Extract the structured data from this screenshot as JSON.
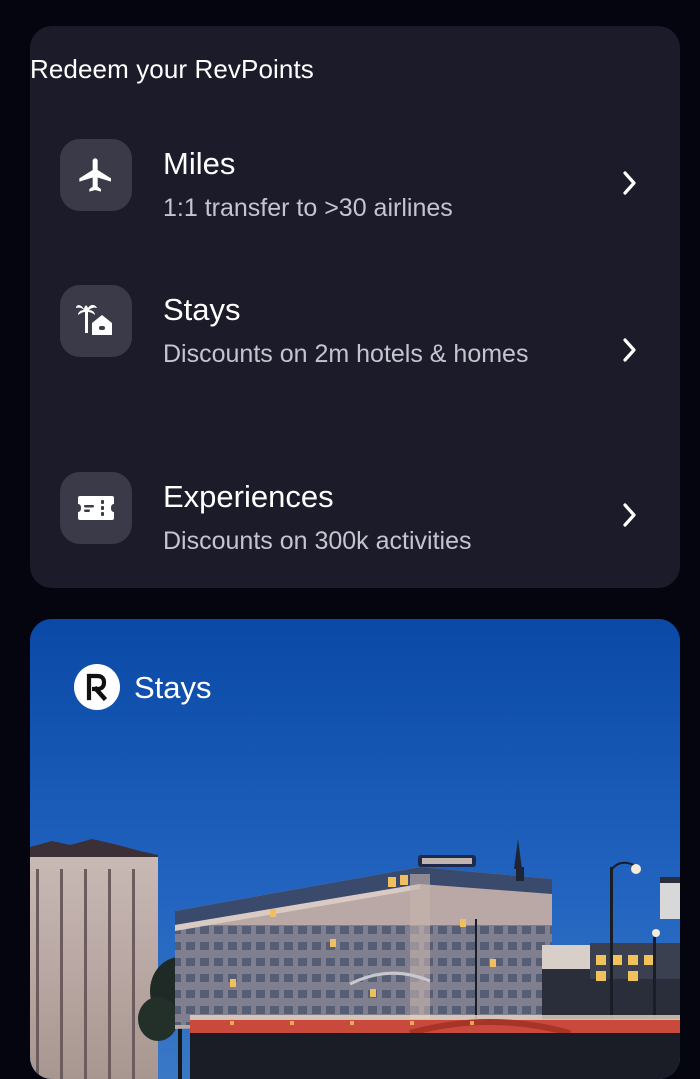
{
  "redeem": {
    "title": "Redeem your RevPoints",
    "items": [
      {
        "icon": "airplane-icon",
        "title": "Miles",
        "subtitle": "1:1 transfer to >30 airlines"
      },
      {
        "icon": "palm-house-icon",
        "title": "Stays",
        "subtitle": "Discounts on 2m hotels & homes"
      },
      {
        "icon": "ticket-icon",
        "title": "Experiences",
        "subtitle": "Discounts on 300k activities"
      }
    ]
  },
  "promo": {
    "logo_icon": "revolut-r-logo",
    "title": "Stays"
  },
  "colors": {
    "background": "#05050f",
    "card": "#1c1b29",
    "icon_tile": "#3a3a48",
    "subtitle_text": "#c5c5d0",
    "promo_sky": "#1356b8"
  }
}
